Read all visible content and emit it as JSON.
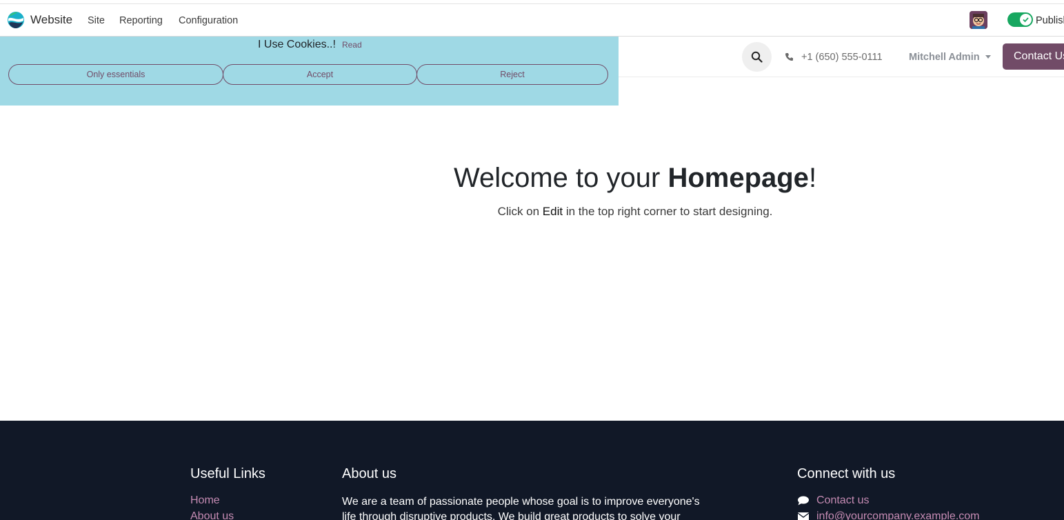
{
  "app": {
    "name": "Website",
    "menu": [
      "Site",
      "Reporting",
      "Configuration"
    ],
    "publish_label": "Publish"
  },
  "site_header": {
    "phone": "+1 (650) 555-0111",
    "user": "Mitchell Admin",
    "contact_button": "Contact Us"
  },
  "cookie_bar": {
    "title": "I Use Cookies..!",
    "read_link": "Read",
    "buttons": {
      "essentials": "Only essentials",
      "accept": "Accept",
      "reject": "Reject"
    }
  },
  "main": {
    "welcome_prefix": "Welcome to your ",
    "welcome_bold": "Homepage",
    "welcome_suffix": "!",
    "subtitle_prefix": "Click on ",
    "subtitle_bold": "Edit",
    "subtitle_suffix": " in the top right corner to start designing."
  },
  "footer": {
    "useful_links_title": "Useful Links",
    "links": [
      "Home",
      "About us"
    ],
    "about_title": "About us",
    "about_text": "We are a team of passionate people whose goal is to improve everyone's life through disruptive products. We build great products to solve your business problems.",
    "connect_title": "Connect with us",
    "contact_us": "Contact us",
    "email": "info@yourcompany.example.com"
  },
  "colors": {
    "brand": "#714b67",
    "cookie_bg": "#9fd9e5",
    "footer_bg": "#111827",
    "toggle_on": "#17a760",
    "footer_link": "#c58bb3"
  },
  "icons": [
    "website-logo-icon",
    "user-avatar-icon",
    "check-icon",
    "search-icon",
    "phone-icon",
    "caret-down-icon",
    "chat-bubble-icon",
    "envelope-icon"
  ]
}
